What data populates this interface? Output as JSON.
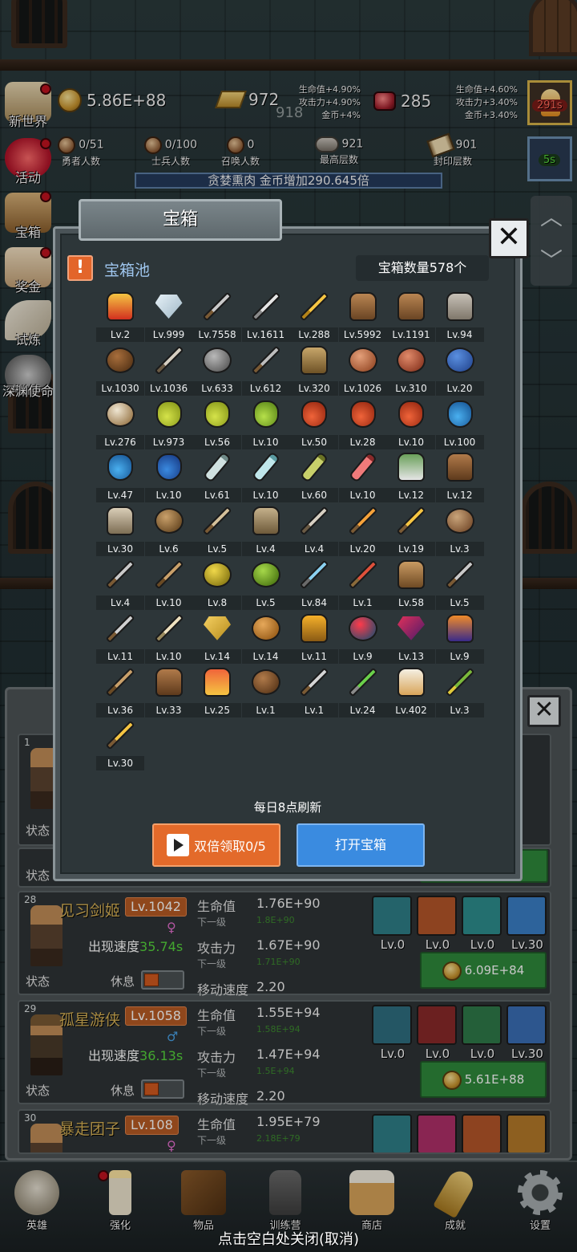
{
  "hud": {
    "gold": "5.86E+88",
    "ingot": "972",
    "ingot_faded": "918",
    "gem": "285",
    "buffs_left": [
      "生命值+4.90%",
      "攻击力+4.90%",
      "金币+4%"
    ],
    "buffs_right": [
      "生命值+4.60%",
      "攻击力+3.40%",
      "金币+3.40%"
    ],
    "brave_count": "0/51",
    "brave_label": "勇者人数",
    "soldier_count": "0/100",
    "soldier_label": "士兵人数",
    "summon_count": "0",
    "summon_label": "召唤人数",
    "max_floor": "921",
    "max_floor_label": "最高层数",
    "seal_floor": "901",
    "seal_floor_label": "封印层数",
    "buff_banner": "贪婪熏肉 金币增加290.645倍",
    "timer_red": "291s",
    "timer_green": "5s"
  },
  "side_menu": [
    "新世界",
    "活动",
    "宝箱",
    "奖金",
    "试炼",
    "深渊使命"
  ],
  "modal": {
    "tab_title": "宝箱",
    "pool_title": "宝箱池",
    "chest_count": "宝箱数量578个",
    "refresh_note": "每日8点刷新",
    "double_btn": "双倍领取0/5",
    "open_btn": "打开宝箱",
    "items": [
      {
        "icon": "crown",
        "lv": "Lv.2"
      },
      {
        "icon": "diamond",
        "lv": "Lv.999"
      },
      {
        "icon": "sword",
        "lv": "Lv.7558"
      },
      {
        "icon": "sword-steel",
        "lv": "Lv.1611"
      },
      {
        "icon": "sword-gold",
        "lv": "Lv.288"
      },
      {
        "icon": "backpack",
        "lv": "Lv.5992"
      },
      {
        "icon": "backpack-large",
        "lv": "Lv.1191"
      },
      {
        "icon": "armor",
        "lv": "Lv.94"
      },
      {
        "icon": "leather-helmet",
        "lv": "Lv.1030"
      },
      {
        "icon": "dagger",
        "lv": "Lv.1036"
      },
      {
        "icon": "knight-helmet",
        "lv": "Lv.633"
      },
      {
        "icon": "hammer",
        "lv": "Lv.612"
      },
      {
        "icon": "great-helm",
        "lv": "Lv.320"
      },
      {
        "icon": "ham",
        "lv": "Lv.1026"
      },
      {
        "icon": "steak",
        "lv": "Lv.310"
      },
      {
        "icon": "potion-sack",
        "lv": "Lv.20"
      },
      {
        "icon": "flour-bowl",
        "lv": "Lv.276"
      },
      {
        "icon": "potion-yellow",
        "lv": "Lv.973"
      },
      {
        "icon": "potion-yellow",
        "lv": "Lv.56"
      },
      {
        "icon": "potion-green",
        "lv": "Lv.10"
      },
      {
        "icon": "potion-red",
        "lv": "Lv.50"
      },
      {
        "icon": "potion-red",
        "lv": "Lv.28"
      },
      {
        "icon": "potion-red",
        "lv": "Lv.10"
      },
      {
        "icon": "potion-blue",
        "lv": "Lv.100"
      },
      {
        "icon": "potion-blue",
        "lv": "Lv.47"
      },
      {
        "icon": "potion-blue-round",
        "lv": "Lv.10"
      },
      {
        "icon": "vial-grey",
        "lv": "Lv.61"
      },
      {
        "icon": "vial-cyan",
        "lv": "Lv.10"
      },
      {
        "icon": "vial-olive",
        "lv": "Lv.60"
      },
      {
        "icon": "vial-red",
        "lv": "Lv.10"
      },
      {
        "icon": "winged-boots",
        "lv": "Lv.12"
      },
      {
        "icon": "leather-boots",
        "lv": "Lv.12"
      },
      {
        "icon": "gloves",
        "lv": "Lv.30"
      },
      {
        "icon": "round-shield",
        "lv": "Lv.6"
      },
      {
        "icon": "spear",
        "lv": "Lv.5"
      },
      {
        "icon": "kite-shield",
        "lv": "Lv.4"
      },
      {
        "icon": "short-sword",
        "lv": "Lv.4"
      },
      {
        "icon": "torch",
        "lv": "Lv.20"
      },
      {
        "icon": "fire-staff",
        "lv": "Lv.19"
      },
      {
        "icon": "mushroom",
        "lv": "Lv.3"
      },
      {
        "icon": "pickaxe",
        "lv": "Lv.4"
      },
      {
        "icon": "crook",
        "lv": "Lv.10"
      },
      {
        "icon": "lemons",
        "lv": "Lv.8"
      },
      {
        "icon": "limes",
        "lv": "Lv.5"
      },
      {
        "icon": "ice-wand",
        "lv": "Lv.84"
      },
      {
        "icon": "ruby-staff",
        "lv": "Lv.1"
      },
      {
        "icon": "pack",
        "lv": "Lv.58"
      },
      {
        "icon": "shovel",
        "lv": "Lv.5"
      },
      {
        "icon": "axe",
        "lv": "Lv.11"
      },
      {
        "icon": "bone-club",
        "lv": "Lv.10"
      },
      {
        "icon": "cheese",
        "lv": "Lv.14"
      },
      {
        "icon": "pie",
        "lv": "Lv.14"
      },
      {
        "icon": "honey-jar",
        "lv": "Lv.11"
      },
      {
        "icon": "red-orb",
        "lv": "Lv.9"
      },
      {
        "icon": "crystal",
        "lv": "Lv.13"
      },
      {
        "icon": "magic-cube",
        "lv": "Lv.9"
      },
      {
        "icon": "bow",
        "lv": "Lv.36"
      },
      {
        "icon": "quiver",
        "lv": "Lv.33"
      },
      {
        "icon": "fire-glove",
        "lv": "Lv.25"
      },
      {
        "icon": "belt",
        "lv": "Lv.1"
      },
      {
        "icon": "arrow",
        "lv": "Lv.1"
      },
      {
        "icon": "green-wand",
        "lv": "Lv.24"
      },
      {
        "icon": "beer-mug",
        "lv": "Lv.402"
      },
      {
        "icon": "herb",
        "lv": "Lv.3"
      },
      {
        "icon": "gold-pickaxe",
        "lv": "Lv.30"
      }
    ]
  },
  "hero_list": {
    "rows": [
      {
        "num": "28",
        "name": "见习剑姬",
        "lv": "Lv.1042",
        "gender": "♀",
        "speed_label": "出现速度",
        "speed": "35.74s",
        "status": "状态",
        "rest": "休息",
        "hp_label": "生命值",
        "hp": "1.76E+90",
        "next_label": "下一级",
        "hp_next": "1.8E+90",
        "atk_label": "攻击力",
        "atk": "1.67E+90",
        "atk_next": "1.71E+90",
        "move_label": "移动速度",
        "move": "2.20",
        "skills": [
          "Lv.0",
          "Lv.0",
          "Lv.0",
          "Lv.30"
        ],
        "cost": "6.09E+84"
      },
      {
        "num": "29",
        "name": "孤星游侠",
        "lv": "Lv.1058",
        "gender": "♂",
        "speed_label": "出现速度",
        "speed": "36.13s",
        "status": "状态",
        "rest": "休息",
        "hp_label": "生命值",
        "hp": "1.55E+94",
        "next_label": "下一级",
        "hp_next": "1.58E+94",
        "atk_label": "攻击力",
        "atk": "1.47E+94",
        "atk_next": "1.5E+94",
        "move_label": "移动速度",
        "move": "2.20",
        "skills": [
          "Lv.0",
          "Lv.0",
          "Lv.0",
          "Lv.30"
        ],
        "cost": "5.61E+88"
      },
      {
        "num": "30",
        "name": "暴走团子",
        "lv": "Lv.108",
        "hp_label": "生命值",
        "hp": "1.95E+79",
        "next_label": "下一级",
        "hp_next": "2.18E+79"
      }
    ],
    "partial_row_num": "1",
    "partial_status": "状态"
  },
  "bottom_nav": [
    "英雄",
    "强化",
    "物品",
    "训练营",
    "商店",
    "成就",
    "设置"
  ],
  "close_hint": "点击空白处关闭(取消)",
  "colors": {
    "accent_orange": "#e36a2a",
    "accent_blue": "#3a8be0",
    "buy_green": "#2f8a3c"
  }
}
